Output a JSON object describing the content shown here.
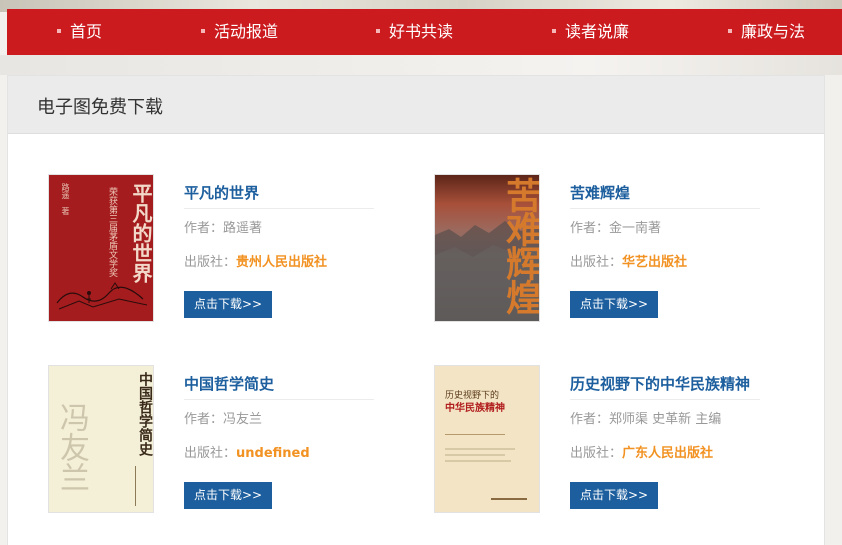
{
  "nav": {
    "items": [
      {
        "label": "首页"
      },
      {
        "label": "活动报道"
      },
      {
        "label": "好书共读"
      },
      {
        "label": "读者说廉"
      },
      {
        "label": "廉政与法"
      }
    ]
  },
  "panel": {
    "title": "电子图免费下载"
  },
  "books": [
    {
      "title": "平凡的世界",
      "author": "作者：路遥著",
      "publisher_label": "出版社：",
      "publisher": "贵州人民出版社",
      "button": "点击下载>>",
      "cover": {
        "title_big": "平凡的世界",
        "subtitle": "荣获第三届茅盾文学奖",
        "author": "路遥　著"
      }
    },
    {
      "title": "苦难辉煌",
      "author": "作者：金一南著",
      "publisher_label": "出版社：",
      "publisher": "华艺出版社",
      "button": "点击下载>>",
      "cover": {
        "title_big": "苦难辉煌"
      }
    },
    {
      "title": "中国哲学简史",
      "author": "作者：冯友兰",
      "publisher_label": "出版社：",
      "publisher": "undefined",
      "button": "点击下载>>",
      "cover": {
        "title_big": "中国哲学简史",
        "author_big": "冯友兰"
      }
    },
    {
      "title": "历史视野下的中华民族精神",
      "author": "作者：郑师渠 史革新 主编",
      "publisher_label": "出版社：",
      "publisher": "广东人民出版社",
      "button": "点击下载>>",
      "cover": {
        "line1": "历史视野下的",
        "line2": "中华民族精神"
      }
    }
  ],
  "colors": {
    "nav_bg": "#cc1b1f",
    "title_blue": "#1d5f9e",
    "publisher_orange": "#f29222",
    "button_bg": "#1d5f9e"
  }
}
